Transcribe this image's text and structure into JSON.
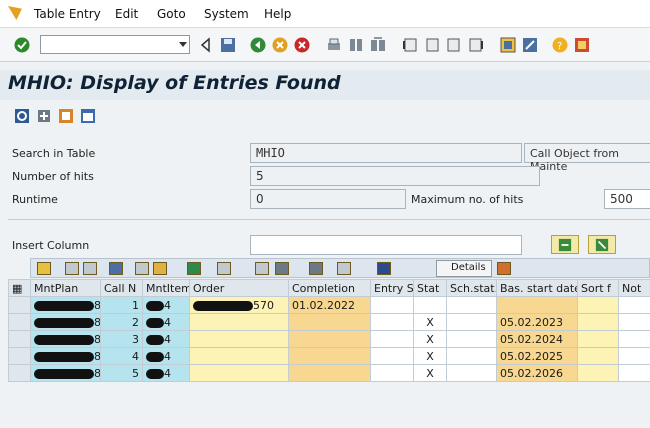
{
  "menu": {
    "items": [
      "Table Entry",
      "Edit",
      "Goto",
      "System",
      "Help"
    ]
  },
  "toolbar": {
    "command_value": ""
  },
  "title": "MHIO: Display of Entries Found",
  "form": {
    "search_label": "Search in Table",
    "search_value": "MHIO",
    "search_desc": "Call Object from Mainte",
    "hits_label": "Number of hits",
    "hits_value": "5",
    "runtime_label": "Runtime",
    "runtime_value": "0",
    "maxhits_label": "Maximum no. of hits",
    "maxhits_value": "500",
    "insert_label": "Insert Column",
    "insert_value": ""
  },
  "grid_toolbar": {
    "details_label": "Details"
  },
  "table": {
    "columns": [
      "MntPlan",
      "Call N",
      "MntItem",
      "Order",
      "Completion",
      "Entry S",
      "Stat",
      "Sch.stat.",
      "Bas. start date",
      "Sort f",
      "Not"
    ],
    "rows": [
      {
        "mntplan": "83",
        "call": "1",
        "item": "4",
        "order": "570",
        "completion": "01.02.2022",
        "entry": "",
        "stat": "",
        "sch": "",
        "basdate": "",
        "sort": "",
        "not": ""
      },
      {
        "mntplan": "83",
        "call": "2",
        "item": "4",
        "order": "",
        "completion": "",
        "entry": "",
        "stat": "X",
        "sch": "",
        "basdate": "05.02.2023",
        "sort": "",
        "not": ""
      },
      {
        "mntplan": "83",
        "call": "3",
        "item": "4",
        "order": "",
        "completion": "",
        "entry": "",
        "stat": "X",
        "sch": "",
        "basdate": "05.02.2024",
        "sort": "",
        "not": ""
      },
      {
        "mntplan": "83",
        "call": "4",
        "item": "4",
        "order": "",
        "completion": "",
        "entry": "",
        "stat": "X",
        "sch": "",
        "basdate": "05.02.2025",
        "sort": "",
        "not": ""
      },
      {
        "mntplan": "83",
        "call": "5",
        "item": "4",
        "order": "",
        "completion": "",
        "entry": "",
        "stat": "X",
        "sch": "",
        "basdate": "05.02.2026",
        "sort": "",
        "not": ""
      }
    ]
  },
  "colors": {
    "key_col": "#b6e4ee",
    "order_col": "#fcf3b4",
    "date_col": "#f8d890",
    "title_bg": "#e3eaf0"
  }
}
